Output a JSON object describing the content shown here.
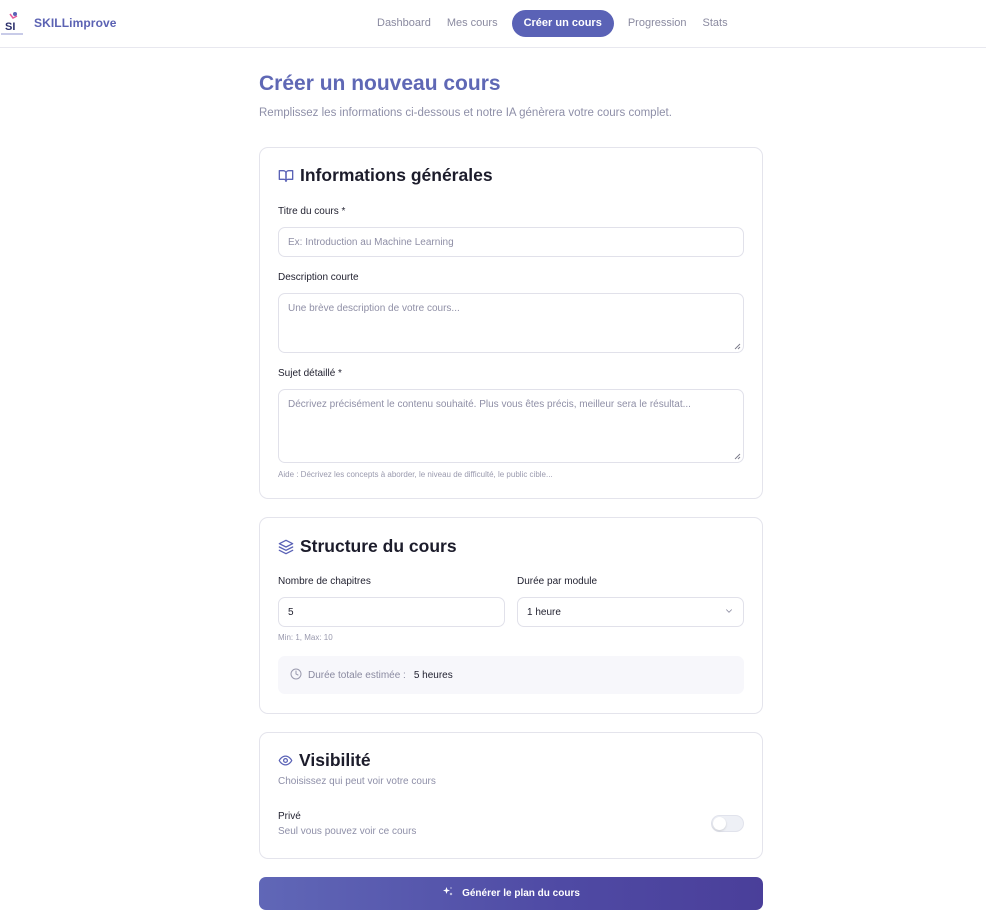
{
  "app": {
    "name": "SKILLimprove",
    "logo_text": "SI"
  },
  "nav": {
    "items": [
      {
        "label": "Dashboard"
      },
      {
        "label": "Mes cours"
      },
      {
        "label": "Créer un cours",
        "active": true
      },
      {
        "label": "Progression"
      },
      {
        "label": "Stats"
      }
    ]
  },
  "header": {
    "title": "Créer un nouveau cours",
    "subtitle": "Remplissez les informations ci-dessous et notre IA génèrera votre cours complet."
  },
  "general": {
    "title": "Informations générales",
    "icon": "book-open-icon",
    "course_title_label": "Titre du cours *",
    "course_title_placeholder": "Ex: Introduction au Machine Learning",
    "short_desc_label": "Description courte",
    "short_desc_placeholder": "Une brève description de votre cours...",
    "detailed_label": "Sujet détaillé *",
    "detailed_placeholder": "Décrivez précisément le contenu souhaité. Plus vous êtes précis, meilleur sera le résultat...",
    "help": "Aide : Décrivez les concepts à aborder, le niveau de difficulté, le public cible..."
  },
  "structure": {
    "title": "Structure du cours",
    "icon": "layers-icon",
    "chapters_label": "Nombre de chapitres",
    "chapters_value": "5",
    "chapters_help": "Min: 1, Max: 10",
    "duration_label": "Durée par module",
    "duration_value": "1 heure",
    "total_label": "Durée totale estimée :",
    "total_value": "5 heures"
  },
  "visibility": {
    "title": "Visibilité",
    "icon": "eye-icon",
    "subtitle": "Choisissez qui peut voir votre cours",
    "private_label": "Privé",
    "private_desc": "Seul vous pouvez voir ce cours",
    "private_enabled": false
  },
  "generate_button": {
    "label": "Générer le plan du cours",
    "icon": "sparkles-icon"
  },
  "colors": {
    "accent": "#5a62b6",
    "title": "#5f68b5",
    "border": "#e4e4ec"
  }
}
